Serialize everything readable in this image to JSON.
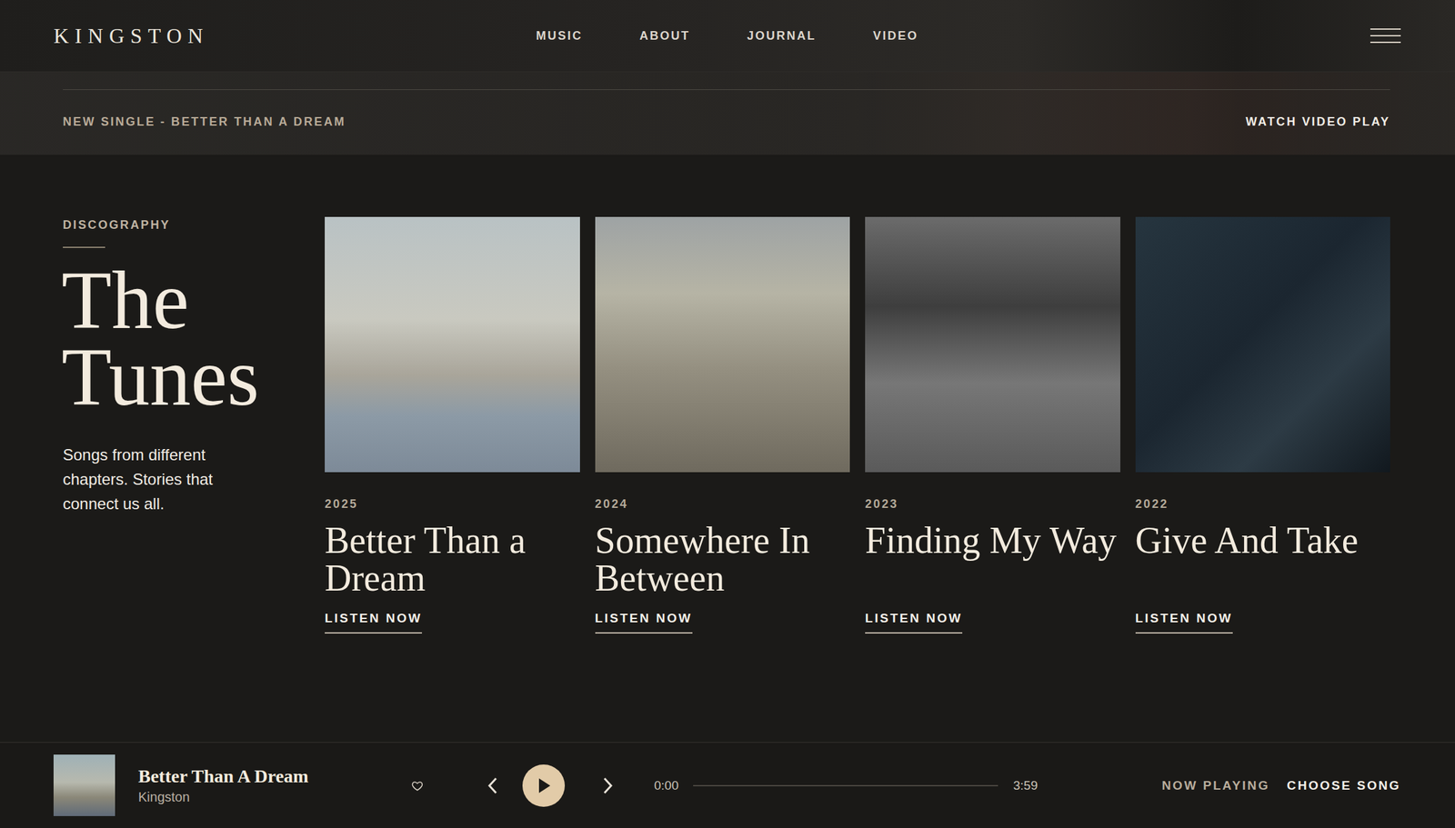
{
  "header": {
    "logo": "KINGSTON",
    "nav": [
      {
        "label": "MUSIC"
      },
      {
        "label": "ABOUT"
      },
      {
        "label": "JOURNAL"
      },
      {
        "label": "VIDEO"
      }
    ]
  },
  "banner": {
    "announcement": "NEW SINGLE - BETTER THAN A DREAM",
    "link": "WATCH VIDEO PLAY"
  },
  "discography": {
    "eyebrow": "DISCOGRAPHY",
    "title": "The Tunes",
    "description": "Songs from different chapters. Stories that connect us all.",
    "albums": [
      {
        "year": "2025",
        "title": "Better Than a Dream",
        "action": "LISTEN NOW"
      },
      {
        "year": "2024",
        "title": "Somewhere In Between",
        "action": "LISTEN NOW"
      },
      {
        "year": "2023",
        "title": "Finding My Way",
        "action": "LISTEN NOW"
      },
      {
        "year": "2022",
        "title": "Give And Take",
        "action": "LISTEN NOW"
      }
    ]
  },
  "player": {
    "title": "Better Than A Dream",
    "artist": "Kingston",
    "liked": false,
    "playing": false,
    "elapsed": "0:00",
    "duration": "3:59",
    "level": 0,
    "now_playing": "NOW PLAYING",
    "choose": "CHOOSE SONG"
  }
}
